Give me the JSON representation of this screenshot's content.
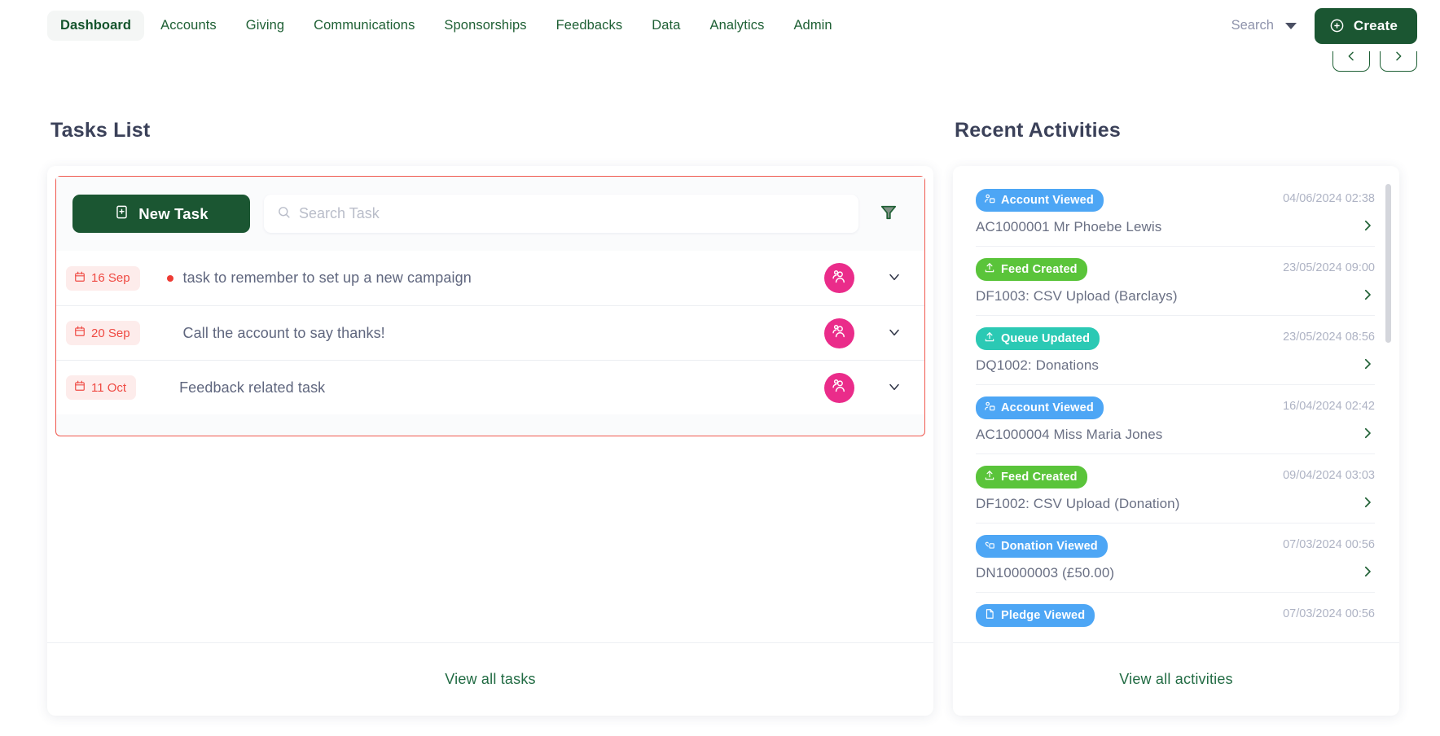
{
  "nav": {
    "items": [
      {
        "label": "Dashboard",
        "active": true
      },
      {
        "label": "Accounts",
        "active": false
      },
      {
        "label": "Giving",
        "active": false
      },
      {
        "label": "Communications",
        "active": false
      },
      {
        "label": "Sponsorships",
        "active": false
      },
      {
        "label": "Feedbacks",
        "active": false
      },
      {
        "label": "Data",
        "active": false
      },
      {
        "label": "Analytics",
        "active": false
      },
      {
        "label": "Admin",
        "active": false
      }
    ],
    "search_label": "Search",
    "create_label": "Create"
  },
  "carousel": {
    "prev_icon": "chevron-left-icon",
    "next_icon": "chevron-right-icon"
  },
  "tasks": {
    "title": "Tasks List",
    "new_task_label": "New Task",
    "search_placeholder": "Search Task",
    "search_value": "",
    "filter_icon": "funnel-filter-icon",
    "footer_label": "View all tasks",
    "rows": [
      {
        "date": "16 Sep",
        "label": "task to remember to set up a new campaign",
        "flagged": true
      },
      {
        "date": "20 Sep",
        "label": "Call the account to say thanks!",
        "flagged": false
      },
      {
        "date": "11 Oct",
        "label": "Feedback related task",
        "flagged": false
      }
    ]
  },
  "activities": {
    "title": "Recent Activities",
    "footer_label": "View all activities",
    "items": [
      {
        "badge": "Account Viewed",
        "badge_color": "#4da6f5",
        "icon": "account-viewed-icon",
        "desc": "AC1000001 Mr Phoebe Lewis",
        "time": "04/06/2024 02:38"
      },
      {
        "badge": "Feed Created",
        "badge_color": "#5ac43a",
        "icon": "upload-icon",
        "desc": "DF1003: CSV Upload (Barclays)",
        "time": "23/05/2024 09:00"
      },
      {
        "badge": "Queue Updated",
        "badge_color": "#2bc9b4",
        "icon": "upload-icon",
        "desc": "DQ1002: Donations",
        "time": "23/05/2024 08:56"
      },
      {
        "badge": "Account Viewed",
        "badge_color": "#4da6f5",
        "icon": "account-viewed-icon",
        "desc": "AC1000004 Miss Maria Jones",
        "time": "16/04/2024 02:42"
      },
      {
        "badge": "Feed Created",
        "badge_color": "#5ac43a",
        "icon": "upload-icon",
        "desc": "DF1002: CSV Upload (Donation)",
        "time": "09/04/2024 03:03"
      },
      {
        "badge": "Donation Viewed",
        "badge_color": "#4da6f5",
        "icon": "donation-viewed-icon",
        "desc": "DN10000003 (£50.00)",
        "time": "07/03/2024 00:56"
      },
      {
        "badge": "Pledge Viewed",
        "badge_color": "#4da6f5",
        "icon": "document-icon",
        "desc": "",
        "time": "07/03/2024 00:56"
      }
    ]
  },
  "colors": {
    "brand_green": "#1b5632",
    "accent_pink": "#ea2c8a",
    "alert_red": "#f0584e",
    "heading": "#3b4159"
  }
}
